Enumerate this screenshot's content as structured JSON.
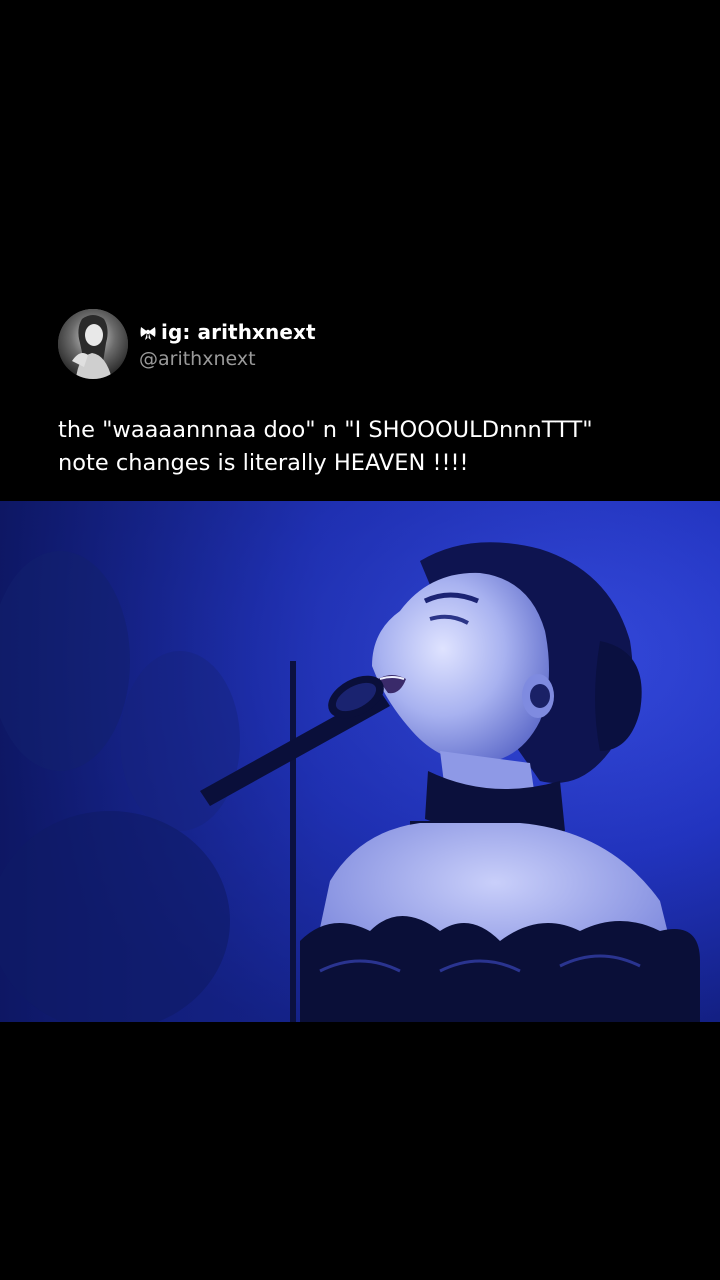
{
  "post": {
    "author": {
      "display_name": "ig: arithxnext",
      "handle": "@arithxnext",
      "badge_icon": "bow-icon",
      "avatar_icon": "profile-avatar"
    },
    "text_lines": [
      "the \"waaaannnaa doo\" n \"I SHOOOULDnnnTTT\"",
      "note changes is literally HEAVEN !!!!"
    ]
  },
  "media": {
    "type": "video-frame",
    "dominant_color": "#2536c4"
  },
  "colors": {
    "background": "#000000",
    "primary_text": "#ffffff",
    "secondary_text": "#9a9a9a"
  }
}
